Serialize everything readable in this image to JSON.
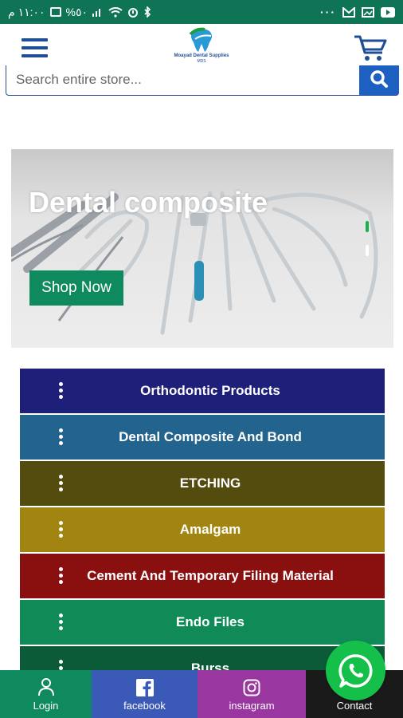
{
  "status_bar": {
    "time": "١١:٠٠ م",
    "battery": "%٥٠"
  },
  "header": {
    "brand_line1": "Moayad Dental Supplies",
    "brand_line2": "MDS"
  },
  "search": {
    "placeholder": "Search entire store..."
  },
  "banner": {
    "title": "Dental composite",
    "button_label": "Shop Now"
  },
  "categories": [
    {
      "label": "Orthodontic Products",
      "color": "#1e1f78"
    },
    {
      "label": "Dental Composite And Bond",
      "color": "#23648f"
    },
    {
      "label": "ETCHING",
      "color": "#544b0f"
    },
    {
      "label": "Amalgam",
      "color": "#a28411"
    },
    {
      "label": "Cement And Temporary Filing Material",
      "color": "#8a1010"
    },
    {
      "label": "Endo Files",
      "color": "#108a57"
    },
    {
      "label": "Burss",
      "color": "#0b5b39"
    }
  ],
  "bottom_nav": [
    {
      "label": "Login",
      "icon": "user-icon",
      "color": "#0f8a5e"
    },
    {
      "label": "facebook",
      "icon": "facebook-icon",
      "color": "#3b5ab7"
    },
    {
      "label": "instagram",
      "icon": "instagram-icon",
      "color": "#9a36a0"
    },
    {
      "label": "Contact",
      "icon": "whatsapp-icon",
      "color": "#1a1a1a"
    }
  ],
  "colors": {
    "status_bar": "#0f7355",
    "brand_blue": "#1f4e96",
    "search_button": "#1e5fc2",
    "whatsapp_green": "#15c04a"
  }
}
